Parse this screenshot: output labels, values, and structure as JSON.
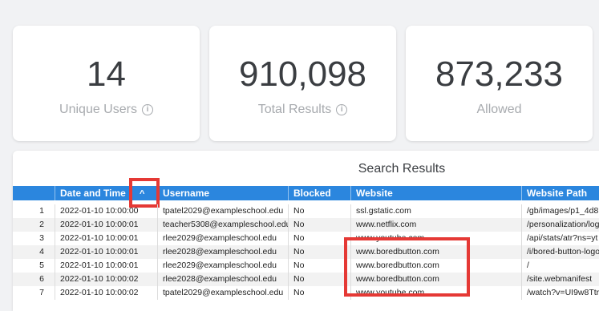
{
  "cards": [
    {
      "value": "14",
      "label": "Unique Users",
      "info": true
    },
    {
      "value": "910,098",
      "label": "Total Results",
      "info": true
    },
    {
      "value": "873,233",
      "label": "Allowed",
      "info": false
    }
  ],
  "table": {
    "title": "Search Results",
    "columns": [
      "",
      "Date and Time",
      "Username",
      "Blocked",
      "Website",
      "Website Path"
    ],
    "sort_indicator": "^",
    "rows": [
      [
        "1",
        "2022-01-10 10:00:00",
        "tpatel2029@exampleschool.edu",
        "No",
        "ssl.gstatic.com",
        "/gb/images/p1_4d8"
      ],
      [
        "2",
        "2022-01-10 10:00:01",
        "teacher5308@exampleschool.edu",
        "No",
        "www.netflix.com",
        "/personalization/log"
      ],
      [
        "3",
        "2022-01-10 10:00:01",
        "rlee2029@exampleschool.edu",
        "No",
        "www.youtube.com",
        "/api/stats/atr?ns=yt"
      ],
      [
        "4",
        "2022-01-10 10:00:01",
        "rlee2028@exampleschool.edu",
        "No",
        "www.boredbutton.com",
        "/i/bored-button-logo"
      ],
      [
        "5",
        "2022-01-10 10:00:01",
        "rlee2029@exampleschool.edu",
        "No",
        "www.boredbutton.com",
        "/"
      ],
      [
        "6",
        "2022-01-10 10:00:02",
        "rlee2028@exampleschool.edu",
        "No",
        "www.boredbutton.com",
        "/site.webmanifest"
      ],
      [
        "7",
        "2022-01-10 10:00:02",
        "tpatel2029@exampleschool.edu",
        "No",
        "www.youtube.com",
        "/watch?v=UI9w8Ttr"
      ]
    ]
  },
  "colors": {
    "header_bg": "#2b86de",
    "annotation": "#e53935"
  },
  "icons": {
    "info": "info-circle-icon",
    "sort": "chevron-up-icon"
  }
}
